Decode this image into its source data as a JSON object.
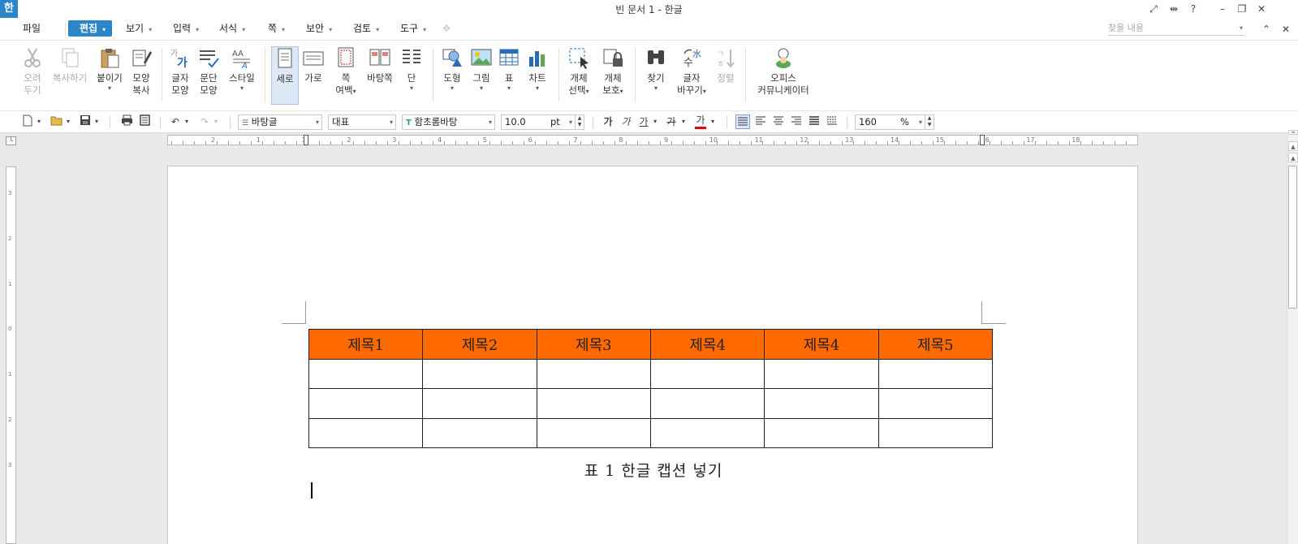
{
  "titlebar": {
    "app_logo": "한",
    "title": "빈 문서 1 - 한글",
    "help": "?"
  },
  "menubar": {
    "file": "파일",
    "items": [
      {
        "label": "편집",
        "active": true
      },
      {
        "label": "보기"
      },
      {
        "label": "입력"
      },
      {
        "label": "서식"
      },
      {
        "label": "쪽"
      },
      {
        "label": "보안"
      },
      {
        "label": "검토"
      },
      {
        "label": "도구"
      }
    ],
    "search_placeholder": "찾을 내용"
  },
  "ribbon": {
    "cut": {
      "line1": "오려",
      "line2": "두기"
    },
    "copy": {
      "line1": "복사하기"
    },
    "paste": {
      "line1": "붙이기"
    },
    "format_copy": {
      "line1": "모양",
      "line2": "복사"
    },
    "char_shape": {
      "line1": "글자",
      "line2": "모양"
    },
    "para_shape": {
      "line1": "문단",
      "line2": "모양"
    },
    "style": {
      "line1": "스타일"
    },
    "portrait": {
      "line1": "세로"
    },
    "landscape": {
      "line1": "가로"
    },
    "page_margin": {
      "line1": "쪽",
      "line2": "여백"
    },
    "master_page": {
      "line1": "바탕쪽"
    },
    "columns": {
      "line1": "단"
    },
    "shape": {
      "line1": "도형"
    },
    "picture": {
      "line1": "그림"
    },
    "table": {
      "line1": "표"
    },
    "chart": {
      "line1": "차트"
    },
    "object_select": {
      "line1": "개체",
      "line2": "선택"
    },
    "object_protect": {
      "line1": "개체",
      "line2": "보호"
    },
    "find": {
      "line1": "찾기"
    },
    "replace": {
      "line1": "글자",
      "line2": "바꾸기"
    },
    "sort": {
      "line1": "정렬"
    },
    "office_communicator": {
      "line1": "오피스",
      "line2": "커뮤니케이터"
    }
  },
  "formatbar": {
    "style_name": "바탕글",
    "lang": "대표",
    "font_name": "함초롬바탕",
    "font_size": "10.0",
    "font_unit": "pt",
    "bold": "가",
    "italic": "가",
    "underline": "가",
    "strike": "가",
    "font_color": "가",
    "zoom": "160",
    "zoom_unit": "%"
  },
  "document": {
    "table_header": [
      "제목1",
      "제목2",
      "제목3",
      "제목4",
      "제목4",
      "제목5"
    ],
    "table_rows": 3,
    "caption": "표 1 한글 캡션 넣기"
  },
  "ruler": {
    "h_numbers": [
      "2",
      "1",
      "1",
      "2",
      "3",
      "4",
      "5",
      "6",
      "7",
      "8",
      "9",
      "10",
      "11",
      "12",
      "13",
      "14",
      "15",
      "16",
      "17",
      "18"
    ],
    "v_numbers": [
      "3",
      "2",
      "1",
      "0",
      "1",
      "2",
      "3"
    ]
  },
  "colors": {
    "accent": "#2a86c9",
    "table_header_bg": "#ff6a00"
  }
}
